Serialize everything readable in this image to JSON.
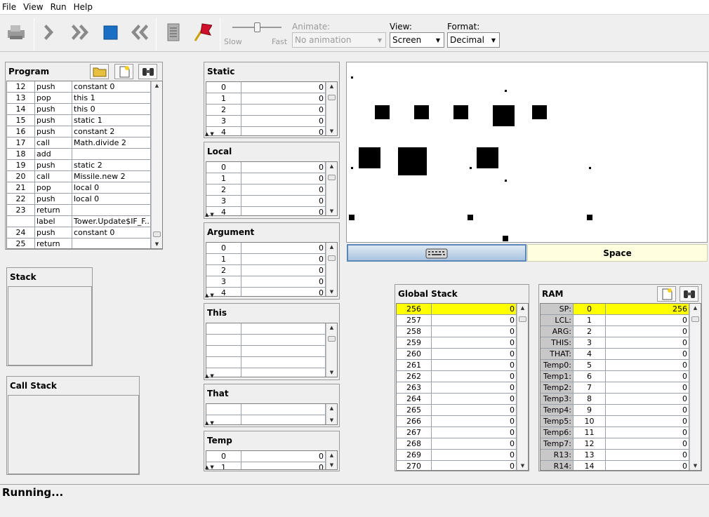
{
  "menu": [
    "File",
    "View",
    "Run",
    "Help"
  ],
  "toolbar": {
    "slider_slow": "Slow",
    "slider_fast": "Fast",
    "animate_label": "Animate:",
    "animate_value": "No animation",
    "view_label": "View:",
    "view_value": "Screen",
    "format_label": "Format:",
    "format_value": "Decimal"
  },
  "program": {
    "title": "Program",
    "rows": [
      [
        "12",
        "push",
        "constant 0"
      ],
      [
        "13",
        "pop",
        "this 1"
      ],
      [
        "14",
        "push",
        "this 0"
      ],
      [
        "15",
        "push",
        "static 1"
      ],
      [
        "16",
        "push",
        "constant 2"
      ],
      [
        "17",
        "call",
        "Math.divide 2"
      ],
      [
        "18",
        "add",
        ""
      ],
      [
        "19",
        "push",
        "static 2"
      ],
      [
        "20",
        "call",
        "Missile.new 2"
      ],
      [
        "21",
        "pop",
        "local 0"
      ],
      [
        "22",
        "push",
        "local 0"
      ],
      [
        "23",
        "return",
        ""
      ],
      [
        "",
        "label",
        "Tower.Update$IF_F..."
      ],
      [
        "24",
        "push",
        "constant 0"
      ],
      [
        "25",
        "return",
        ""
      ]
    ]
  },
  "stack": {
    "title": "Stack"
  },
  "call_stack": {
    "title": "Call Stack"
  },
  "segments": {
    "static": {
      "title": "Static",
      "rows": [
        [
          "0",
          "0"
        ],
        [
          "1",
          "0"
        ],
        [
          "2",
          "0"
        ],
        [
          "3",
          "0"
        ],
        [
          "4",
          "0"
        ]
      ]
    },
    "local": {
      "title": "Local",
      "rows": [
        [
          "0",
          "0"
        ],
        [
          "1",
          "0"
        ],
        [
          "2",
          "0"
        ],
        [
          "3",
          "0"
        ],
        [
          "4",
          "0"
        ]
      ]
    },
    "argument": {
      "title": "Argument",
      "rows": [
        [
          "0",
          "0"
        ],
        [
          "1",
          "0"
        ],
        [
          "2",
          "0"
        ],
        [
          "3",
          "0"
        ],
        [
          "4",
          "0"
        ]
      ]
    },
    "this": {
      "title": "This"
    },
    "that": {
      "title": "That"
    },
    "temp": {
      "title": "Temp",
      "rows": [
        [
          "0",
          "0"
        ],
        [
          "1",
          "0"
        ]
      ]
    }
  },
  "keyboard": {
    "key_pressed": "Space"
  },
  "global_stack": {
    "title": "Global Stack",
    "rows": [
      [
        "256",
        "0"
      ],
      [
        "257",
        "0"
      ],
      [
        "258",
        "0"
      ],
      [
        "259",
        "0"
      ],
      [
        "260",
        "0"
      ],
      [
        "261",
        "0"
      ],
      [
        "262",
        "0"
      ],
      [
        "263",
        "0"
      ],
      [
        "264",
        "0"
      ],
      [
        "265",
        "0"
      ],
      [
        "266",
        "0"
      ],
      [
        "267",
        "0"
      ],
      [
        "268",
        "0"
      ],
      [
        "269",
        "0"
      ],
      [
        "270",
        "0"
      ]
    ]
  },
  "ram": {
    "title": "RAM",
    "rows": [
      [
        "SP:",
        "0",
        "256"
      ],
      [
        "LCL:",
        "1",
        "0"
      ],
      [
        "ARG:",
        "2",
        "0"
      ],
      [
        "THIS:",
        "3",
        "0"
      ],
      [
        "THAT:",
        "4",
        "0"
      ],
      [
        "Temp0:",
        "5",
        "0"
      ],
      [
        "Temp1:",
        "6",
        "0"
      ],
      [
        "Temp2:",
        "7",
        "0"
      ],
      [
        "Temp3:",
        "8",
        "0"
      ],
      [
        "Temp4:",
        "9",
        "0"
      ],
      [
        "Temp5:",
        "10",
        "0"
      ],
      [
        "Temp6:",
        "11",
        "0"
      ],
      [
        "Temp7:",
        "12",
        "0"
      ],
      [
        "R13:",
        "13",
        "0"
      ],
      [
        "R14:",
        "14",
        "0"
      ]
    ]
  },
  "status": "Running..."
}
